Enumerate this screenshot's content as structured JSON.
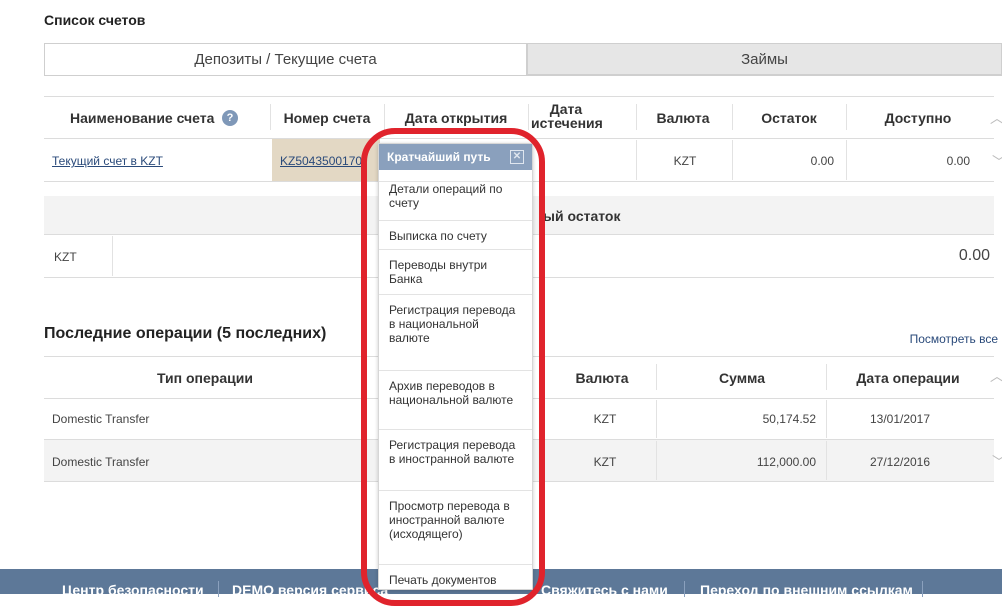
{
  "accounts_section": {
    "title": "Список счетов"
  },
  "tabs": [
    {
      "label": "Депозиты / Текущие счета",
      "active": true
    },
    {
      "label": "Займы",
      "active": false
    }
  ],
  "accounts_table": {
    "headers": [
      "Наименование счета",
      "Номер счета",
      "Дата открытия",
      "Дата истечения",
      "Валюта",
      "Остаток",
      "Доступно"
    ],
    "info_icon": "question-icon",
    "rows": [
      {
        "name": "Текущий счет в KZT",
        "number": "KZ5043500170.",
        "currency": "KZT",
        "balance": "0.00",
        "available": "0.00"
      }
    ]
  },
  "totals": {
    "header_partial": "ый остаток",
    "currency": "KZT",
    "amount": "0.00"
  },
  "recent_ops": {
    "title": "Последние операции (5 последних)",
    "view_all": "Посмотреть все",
    "headers": [
      "Тип операции",
      "Валюта",
      "Сумма",
      "Дата операции"
    ],
    "rows": [
      {
        "type": "Domestic Transfer",
        "currency": "KZT",
        "amount": "50,174.52",
        "date": "13/01/2017"
      },
      {
        "type": "Domestic Transfer",
        "currency": "KZT",
        "amount": "112,000.00",
        "date": "27/12/2016"
      }
    ]
  },
  "shortcut_menu": {
    "title": "Кратчайший путь",
    "close_icon": "close-icon",
    "items": [
      "Детали операций по счету",
      "Выписка по счету",
      "Переводы внутри Банка",
      "Регистрация перевода в национальной валюте",
      "Архив переводов в национальной валюте",
      "Регистрация перевода в иностранной валюте",
      "Просмотр перевода в иностранной валюте (исходящего)",
      "Печать документов"
    ]
  },
  "footer": {
    "items": [
      "Центр безопасности",
      "DEMO версия сервиса",
      "Свяжитесь с нами",
      "Переход по внешним ссылкам"
    ]
  },
  "colors": {
    "highlight": "#e0232c",
    "popup_header": "#8aa0bd",
    "footer": "#5d7898",
    "account_cell": "#e3d8c4"
  }
}
